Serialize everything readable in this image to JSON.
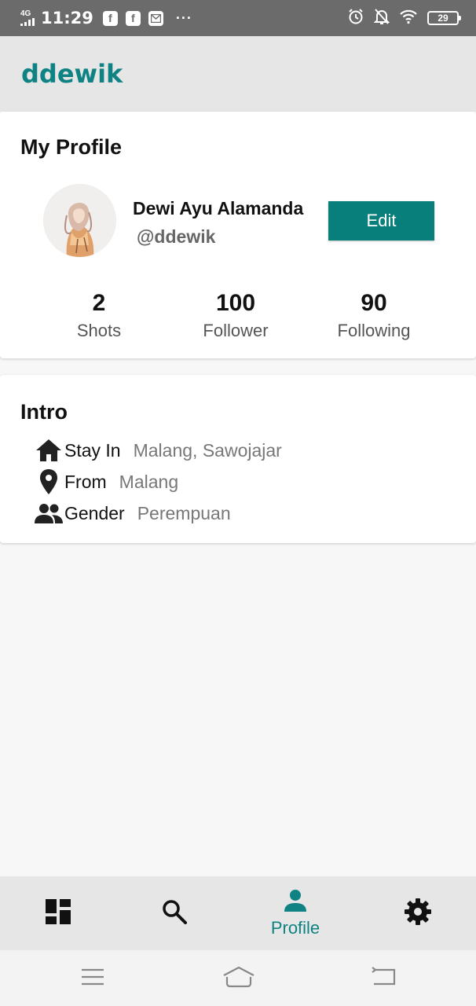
{
  "status_bar": {
    "network": "4G",
    "time": "11:29",
    "battery": "29",
    "notification_icons": [
      "facebook-icon",
      "facebook-icon",
      "message-icon"
    ],
    "right_icons": [
      "alarm-icon",
      "bell-off-icon",
      "wifi-icon",
      "battery-icon"
    ]
  },
  "app_bar": {
    "title": "ddewik",
    "title_color": "#0f8383"
  },
  "profile_card": {
    "title": "My Profile",
    "name": "Dewi Ayu Alamanda",
    "username": "@ddewik",
    "edit_label": "Edit",
    "edit_color": "#087f7b",
    "stats": [
      {
        "value": "2",
        "label": "Shots"
      },
      {
        "value": "100",
        "label": "Follower"
      },
      {
        "value": "90",
        "label": "Following"
      }
    ]
  },
  "intro_card": {
    "title": "Intro",
    "rows": [
      {
        "icon": "home-icon",
        "label": "Stay In",
        "value": "Malang, Sawojajar"
      },
      {
        "icon": "location-pin-icon",
        "label": "From",
        "value": "Malang"
      },
      {
        "icon": "people-icon",
        "label": "Gender",
        "value": "Perempuan"
      }
    ]
  },
  "bottom_nav": {
    "items": [
      {
        "icon": "dashboard-icon",
        "label": ""
      },
      {
        "icon": "search-icon",
        "label": ""
      },
      {
        "icon": "profile-icon",
        "label": "Profile",
        "active": true
      },
      {
        "icon": "settings-icon",
        "label": ""
      }
    ],
    "active_color": "#0f8383"
  },
  "system_nav": {
    "buttons": [
      "menu-icon",
      "home-icon",
      "back-icon"
    ]
  }
}
